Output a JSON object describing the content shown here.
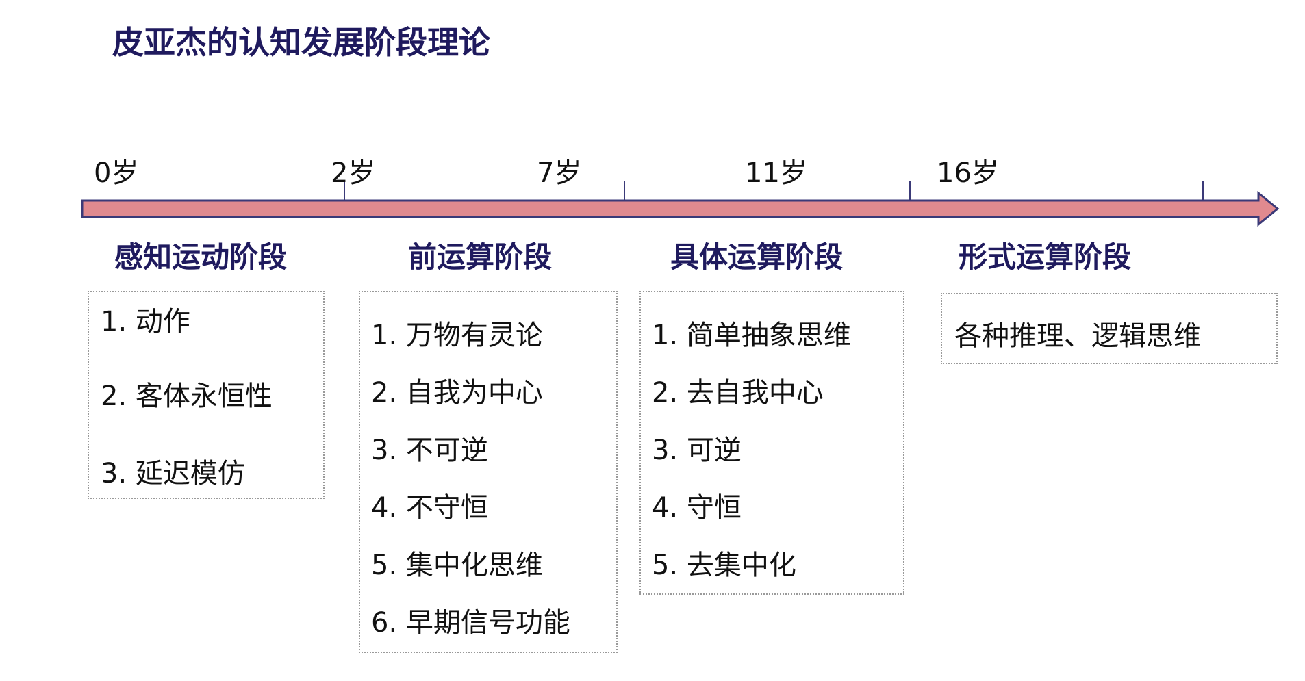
{
  "title": "皮亚杰的认知发展阶段理论",
  "colors": {
    "title": "#1f1a5e",
    "arrow_fill": "#e08a8f",
    "arrow_border": "#3b3a78"
  },
  "ages": [
    "0岁",
    "2岁",
    "7岁",
    "11岁",
    "16岁"
  ],
  "stages": [
    {
      "name": "感知运动阶段",
      "items": [
        "1. 动作",
        "2. 客体永恒性",
        "3. 延迟模仿"
      ]
    },
    {
      "name": "前运算阶段",
      "items": [
        "1. 万物有灵论",
        "2. 自我为中心",
        "3. 不可逆",
        "4. 不守恒",
        "5. 集中化思维",
        "6. 早期信号功能"
      ]
    },
    {
      "name": "具体运算阶段",
      "items": [
        "1. 简单抽象思维",
        "2. 去自我中心",
        "3. 可逆",
        "4. 守恒",
        "5. 去集中化"
      ]
    },
    {
      "name": "形式运算阶段",
      "items": [
        "各种推理、逻辑思维"
      ]
    }
  ]
}
